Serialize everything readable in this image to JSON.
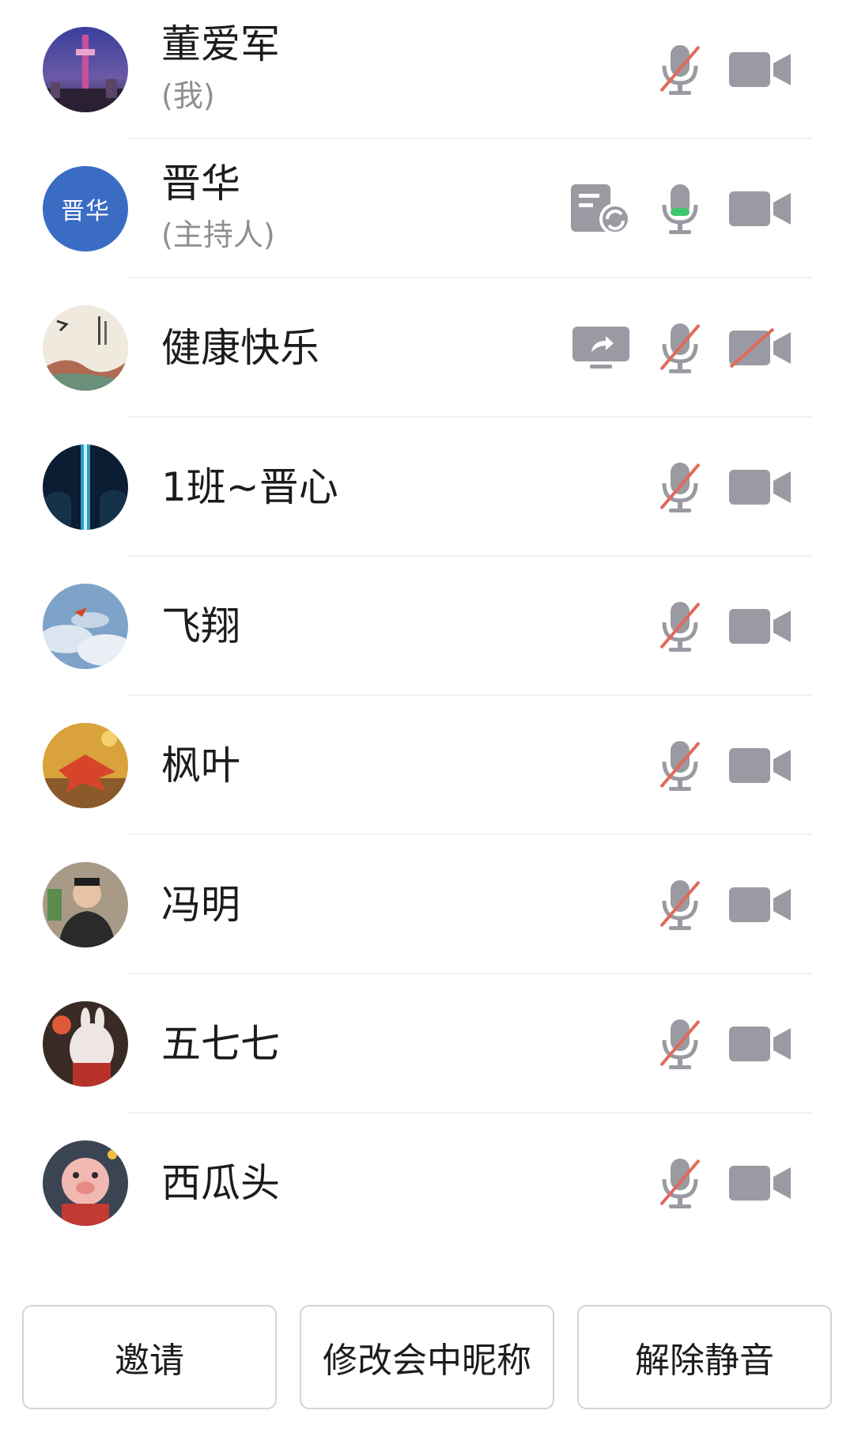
{
  "participants": [
    {
      "name": "董爱军",
      "sub": "(我)",
      "avatar": "city-tower-photo",
      "mic": "muted",
      "video": "on",
      "extra": ""
    },
    {
      "name": "晋华",
      "sub": "(主持人)",
      "avatar_text": "晋华",
      "mic": "speaking",
      "video": "on",
      "extra": "doc-sync-icon"
    },
    {
      "name": "健康快乐",
      "sub": "",
      "avatar": "ink-painting-photo",
      "mic": "muted",
      "video": "off",
      "extra": "screen-share-icon"
    },
    {
      "name": "1班~晋心",
      "sub": "",
      "avatar": "blue-light-photo",
      "mic": "muted",
      "video": "on",
      "extra": ""
    },
    {
      "name": "飞翔",
      "sub": "",
      "avatar": "cloud-sky-photo",
      "mic": "muted",
      "video": "on",
      "extra": ""
    },
    {
      "name": "枫叶",
      "sub": "",
      "avatar": "maple-leaf-photo",
      "mic": "muted",
      "video": "on",
      "extra": ""
    },
    {
      "name": "冯明",
      "sub": "",
      "avatar": "person-portrait-photo",
      "mic": "muted",
      "video": "on",
      "extra": ""
    },
    {
      "name": "五七七",
      "sub": "",
      "avatar": "cartoon-rabbit-photo",
      "mic": "muted",
      "video": "on",
      "extra": ""
    },
    {
      "name": "西瓜头",
      "sub": "",
      "avatar": "cartoon-pig-photo",
      "mic": "muted",
      "video": "on",
      "extra": ""
    }
  ],
  "footer": {
    "invite_label": "邀请",
    "rename_label": "修改会中昵称",
    "unmute_label": "解除静音"
  },
  "colors": {
    "icon_gray": "#9a9aa2",
    "mute_red": "#e06a5a",
    "speaking_green": "#3fc56b",
    "host_avatar": "#3b6cc4"
  }
}
